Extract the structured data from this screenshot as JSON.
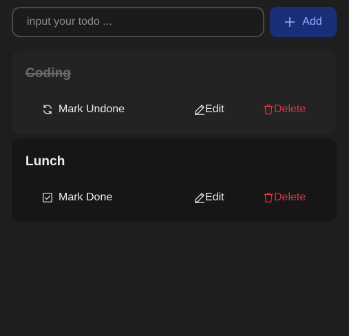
{
  "input": {
    "placeholder": "input your todo ...",
    "value": ""
  },
  "add_button": {
    "label": "Add",
    "icon": "plus-icon"
  },
  "todos": [
    {
      "title": "Coding",
      "completed": true,
      "toggle_label": "Mark Undone",
      "toggle_icon": "refresh-icon",
      "edit_label": "Edit",
      "edit_icon": "pencil-icon",
      "delete_label": "Delete",
      "delete_icon": "trash-icon"
    },
    {
      "title": "Lunch",
      "completed": false,
      "toggle_label": "Mark Done",
      "toggle_icon": "checkbox-icon",
      "edit_label": "Edit",
      "edit_icon": "pencil-icon",
      "delete_label": "Delete",
      "delete_icon": "trash-icon"
    }
  ],
  "colors": {
    "background": "#1e1e1e",
    "accent": "#1a2e7a",
    "accent_text": "#8fb0ff",
    "delete": "#e0343f"
  }
}
